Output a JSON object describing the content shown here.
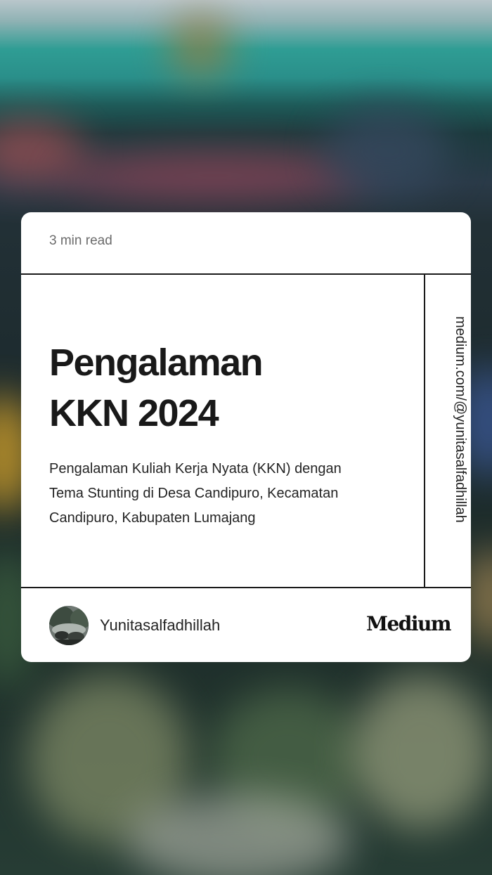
{
  "card": {
    "read_time": "3 min read",
    "title_lines": [
      "Pengalaman",
      "KKN 2024"
    ],
    "subtitle_lines": [
      "Pengalaman Kuliah Kerja Nyata (KKN) dengan",
      "Tema Stunting di Desa Candipuro, Kecamatan",
      "Candipuro, Kabupaten Lumajang"
    ],
    "profile_url": "medium.com/@yunitasalfadhillah",
    "author": "Yunitasalfadhillah",
    "brand": "Medium"
  },
  "colors": {
    "card_background": "#ffffff",
    "rule": "#1a1a1a",
    "text_primary": "#191919",
    "text_muted": "#6b6b6b"
  },
  "icons": {
    "avatar": "profile-photo"
  }
}
